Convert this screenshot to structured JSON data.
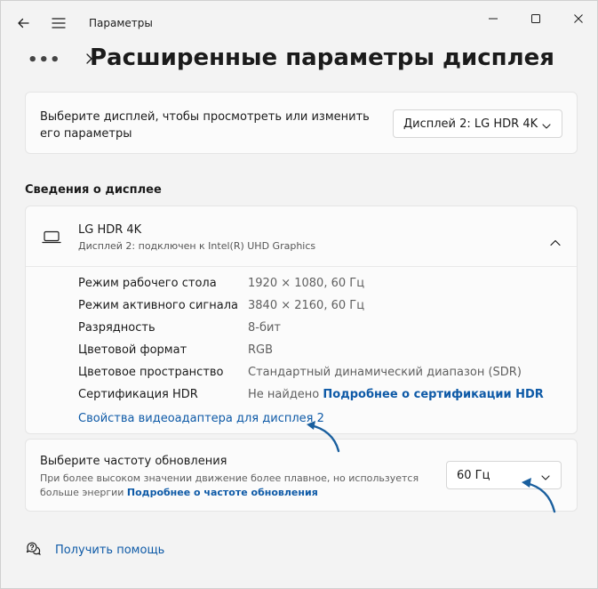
{
  "titlebar": {
    "title": "Параметры",
    "back_icon": "back-arrow-icon",
    "menu_icon": "hamburger-icon"
  },
  "breadcrumb": {
    "overflow": "•••",
    "page_title": "Расширенные параметры дисплея"
  },
  "display_select": {
    "label": "Выберите дисплей, чтобы просмотреть или изменить его параметры",
    "value": "Дисплей 2: LG HDR 4K"
  },
  "section": {
    "title": "Сведения о дисплее"
  },
  "device": {
    "name": "LG HDR 4K",
    "subtitle": "Дисплей 2: подключен к Intel(R) UHD Graphics",
    "rows": [
      {
        "key": "Режим рабочего стола",
        "value": "1920 × 1080, 60 Гц"
      },
      {
        "key": "Режим активного сигнала",
        "value": "3840 × 2160, 60 Гц"
      },
      {
        "key": "Разрядность",
        "value": "8-бит"
      },
      {
        "key": "Цветовой формат",
        "value": "RGB"
      },
      {
        "key": "Цветовое пространство",
        "value": "Стандартный динамический диапазон (SDR)"
      },
      {
        "key": "Сертификация HDR",
        "value": "Не найдено",
        "link": "Подробнее о сертификации HDR"
      }
    ],
    "adapter_link": "Свойства видеоадаптера для дисплея 2"
  },
  "refresh": {
    "title": "Выберите частоту обновления",
    "description": "При более высоком значении движение более плавное, но используется больше энергии",
    "link": "Подробнее о частоте обновления",
    "value": "60 Гц"
  },
  "help": {
    "label": "Получить помощь"
  },
  "colors": {
    "accent": "#0e5aa7",
    "annotation_arrow": "#1a5f9e"
  }
}
